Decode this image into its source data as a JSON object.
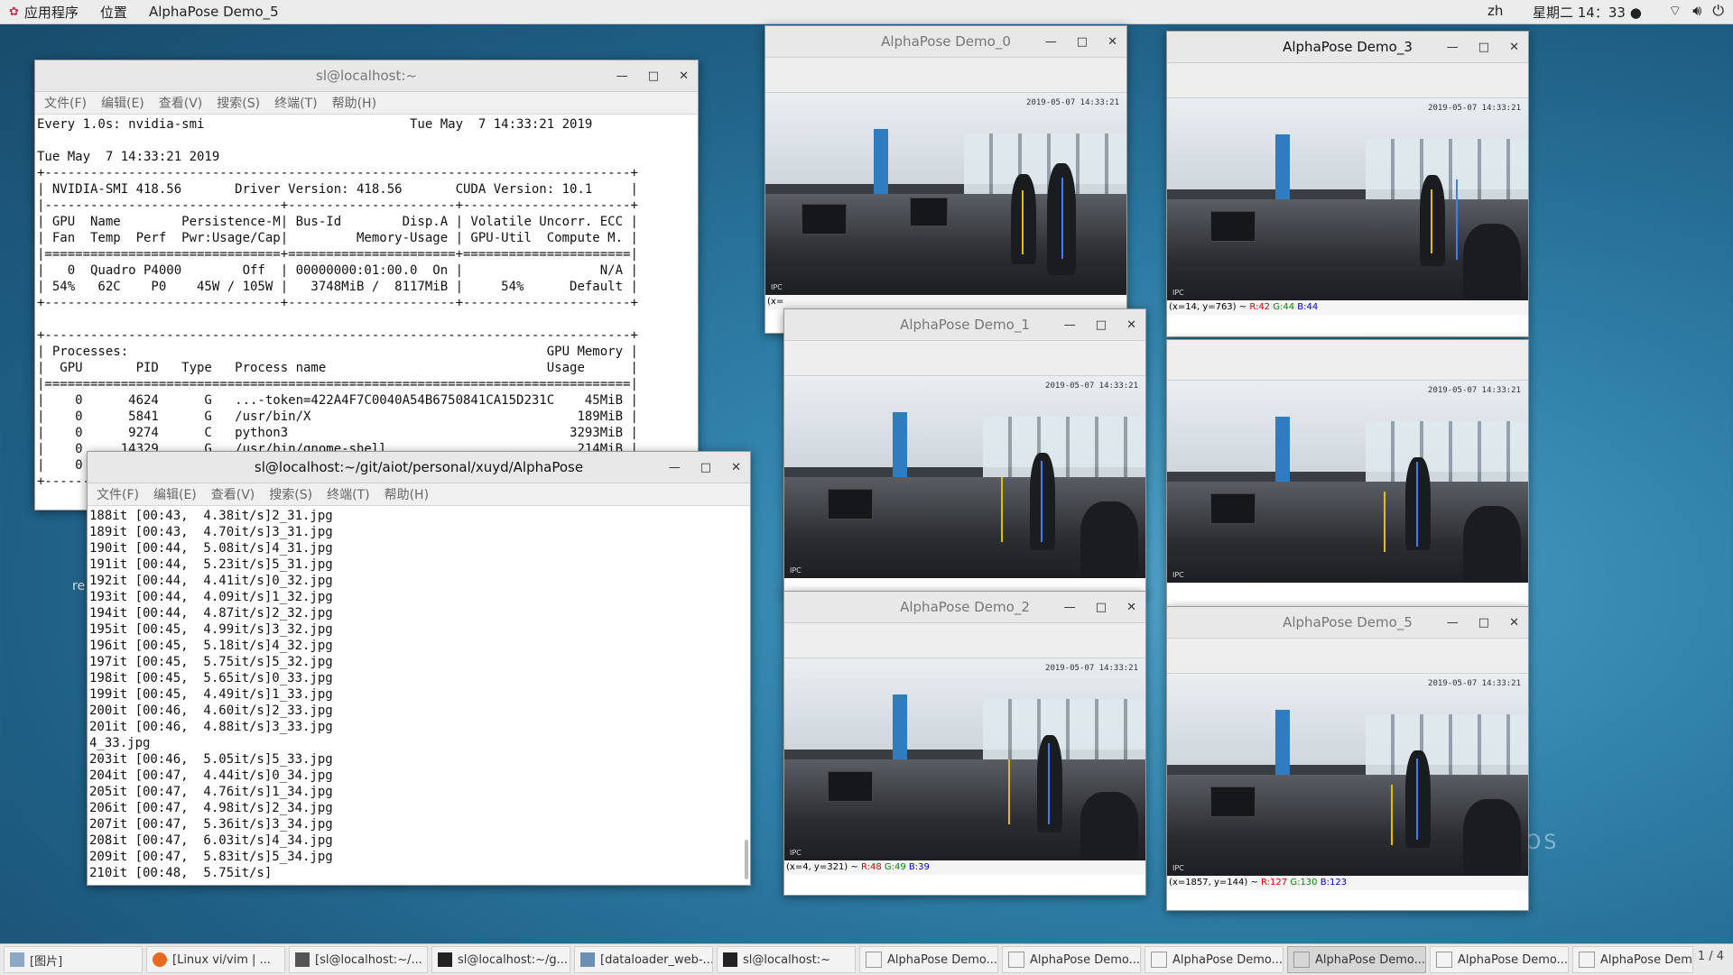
{
  "topbar": {
    "apps": "应用程序",
    "places": "位置",
    "active_window": "AlphaPose Demo_5",
    "lang": "zh",
    "clock": "星期二 14：33 ●"
  },
  "terminal1": {
    "title": "sl@localhost:~",
    "menu": [
      "文件(F)",
      "编辑(E)",
      "查看(V)",
      "搜索(S)",
      "终端(T)",
      "帮助(H)"
    ],
    "content": "Every 1.0s: nvidia-smi                           Tue May  7 14:33:21 2019\n\nTue May  7 14:33:21 2019\n+-----------------------------------------------------------------------------+\n| NVIDIA-SMI 418.56       Driver Version: 418.56       CUDA Version: 10.1     |\n|-------------------------------+----------------------+----------------------+\n| GPU  Name        Persistence-M| Bus-Id        Disp.A | Volatile Uncorr. ECC |\n| Fan  Temp  Perf  Pwr:Usage/Cap|         Memory-Usage | GPU-Util  Compute M. |\n|===============================+======================+======================|\n|   0  Quadro P4000        Off  | 00000000:01:00.0  On |                  N/A |\n| 54%   62C    P0    45W / 105W |   3748MiB /  8117MiB |     54%      Default |\n+-------------------------------+----------------------+----------------------+\n\n+-----------------------------------------------------------------------------+\n| Processes:                                                       GPU Memory |\n|  GPU       PID   Type   Process name                             Usage      |\n|=============================================================================|\n|    0      4624      G   ...-token=422A4F7C0040A54B6750841CA15D231C    45MiB |\n|    0      5841      G   /usr/bin/X                                   189MiB |\n|    0      9274      C   python3                                     3293MiB |\n|    0     14329      G   /usr/bin/gnome-shell                         214MiB |\n|    0                                                                        |\n+-----------------------------------------------------------------------------+"
  },
  "terminal2": {
    "title": "sl@localhost:~/git/aiot/personal/xuyd/AlphaPose",
    "menu": [
      "文件(F)",
      "编辑(E)",
      "查看(V)",
      "搜索(S)",
      "终端(T)",
      "帮助(H)"
    ],
    "content": "188it [00:43,  4.38it/s]2_31.jpg\n189it [00:43,  4.70it/s]3_31.jpg\n190it [00:44,  5.08it/s]4_31.jpg\n191it [00:44,  5.23it/s]5_31.jpg\n192it [00:44,  4.41it/s]0_32.jpg\n193it [00:44,  4.09it/s]1_32.jpg\n194it [00:44,  4.87it/s]2_32.jpg\n195it [00:45,  4.99it/s]3_32.jpg\n196it [00:45,  5.18it/s]4_32.jpg\n197it [00:45,  5.75it/s]5_32.jpg\n198it [00:45,  5.65it/s]0_33.jpg\n199it [00:45,  4.49it/s]1_33.jpg\n200it [00:46,  4.60it/s]2_33.jpg\n201it [00:46,  4.88it/s]3_33.jpg\n4_33.jpg\n203it [00:46,  5.05it/s]5_33.jpg\n204it [00:47,  4.44it/s]0_34.jpg\n205it [00:47,  4.76it/s]1_34.jpg\n206it [00:47,  4.98it/s]2_34.jpg\n207it [00:47,  5.36it/s]3_34.jpg\n208it [00:47,  6.03it/s]4_34.jpg\n209it [00:47,  5.83it/s]5_34.jpg\n210it [00:48,  5.75it/s]"
  },
  "demos": {
    "d0": {
      "title": "AlphaPose Demo_0",
      "status": "(x="
    },
    "d1": {
      "title": "AlphaPose Demo_1",
      "status": ""
    },
    "d2": {
      "title": "AlphaPose Demo_2",
      "status_prefix": "(x=4, y=321) ~ ",
      "r": "R:48",
      "g": "G:49",
      "b": "B:39"
    },
    "d3": {
      "title": "AlphaPose Demo_3",
      "status_prefix": "(x=14, y=763) ~ ",
      "r": "R:42",
      "g": "G:44",
      "b": "B:44"
    },
    "d4": {
      "title": ""
    },
    "d5": {
      "title": "AlphaPose Demo_5",
      "status_prefix": "(x=1857, y=144) ~ ",
      "r": "R:127",
      "g": "G:130",
      "b": "B:123"
    }
  },
  "frame_stamp": "2019-05-07 14:33:21",
  "frame_ipc": "IPC",
  "desktop_text": "OS",
  "desktop_left": "re",
  "taskbar": {
    "items": [
      "[图片]",
      "[Linux vi/vim | ...",
      "[sl@localhost:~/...",
      "sl@localhost:~/g...",
      "[dataloader_web-...",
      "sl@localhost:~",
      "AlphaPose Demo...",
      "AlphaPose Demo...",
      "AlphaPose Demo...",
      "AlphaPose Demo...",
      "AlphaPose Demo...",
      "AlphaPose Demo..."
    ],
    "pager": "1 / 4"
  },
  "colors": {
    "accent_red": "#d00000",
    "accent_green": "#008800",
    "accent_blue": "#0000cc"
  }
}
